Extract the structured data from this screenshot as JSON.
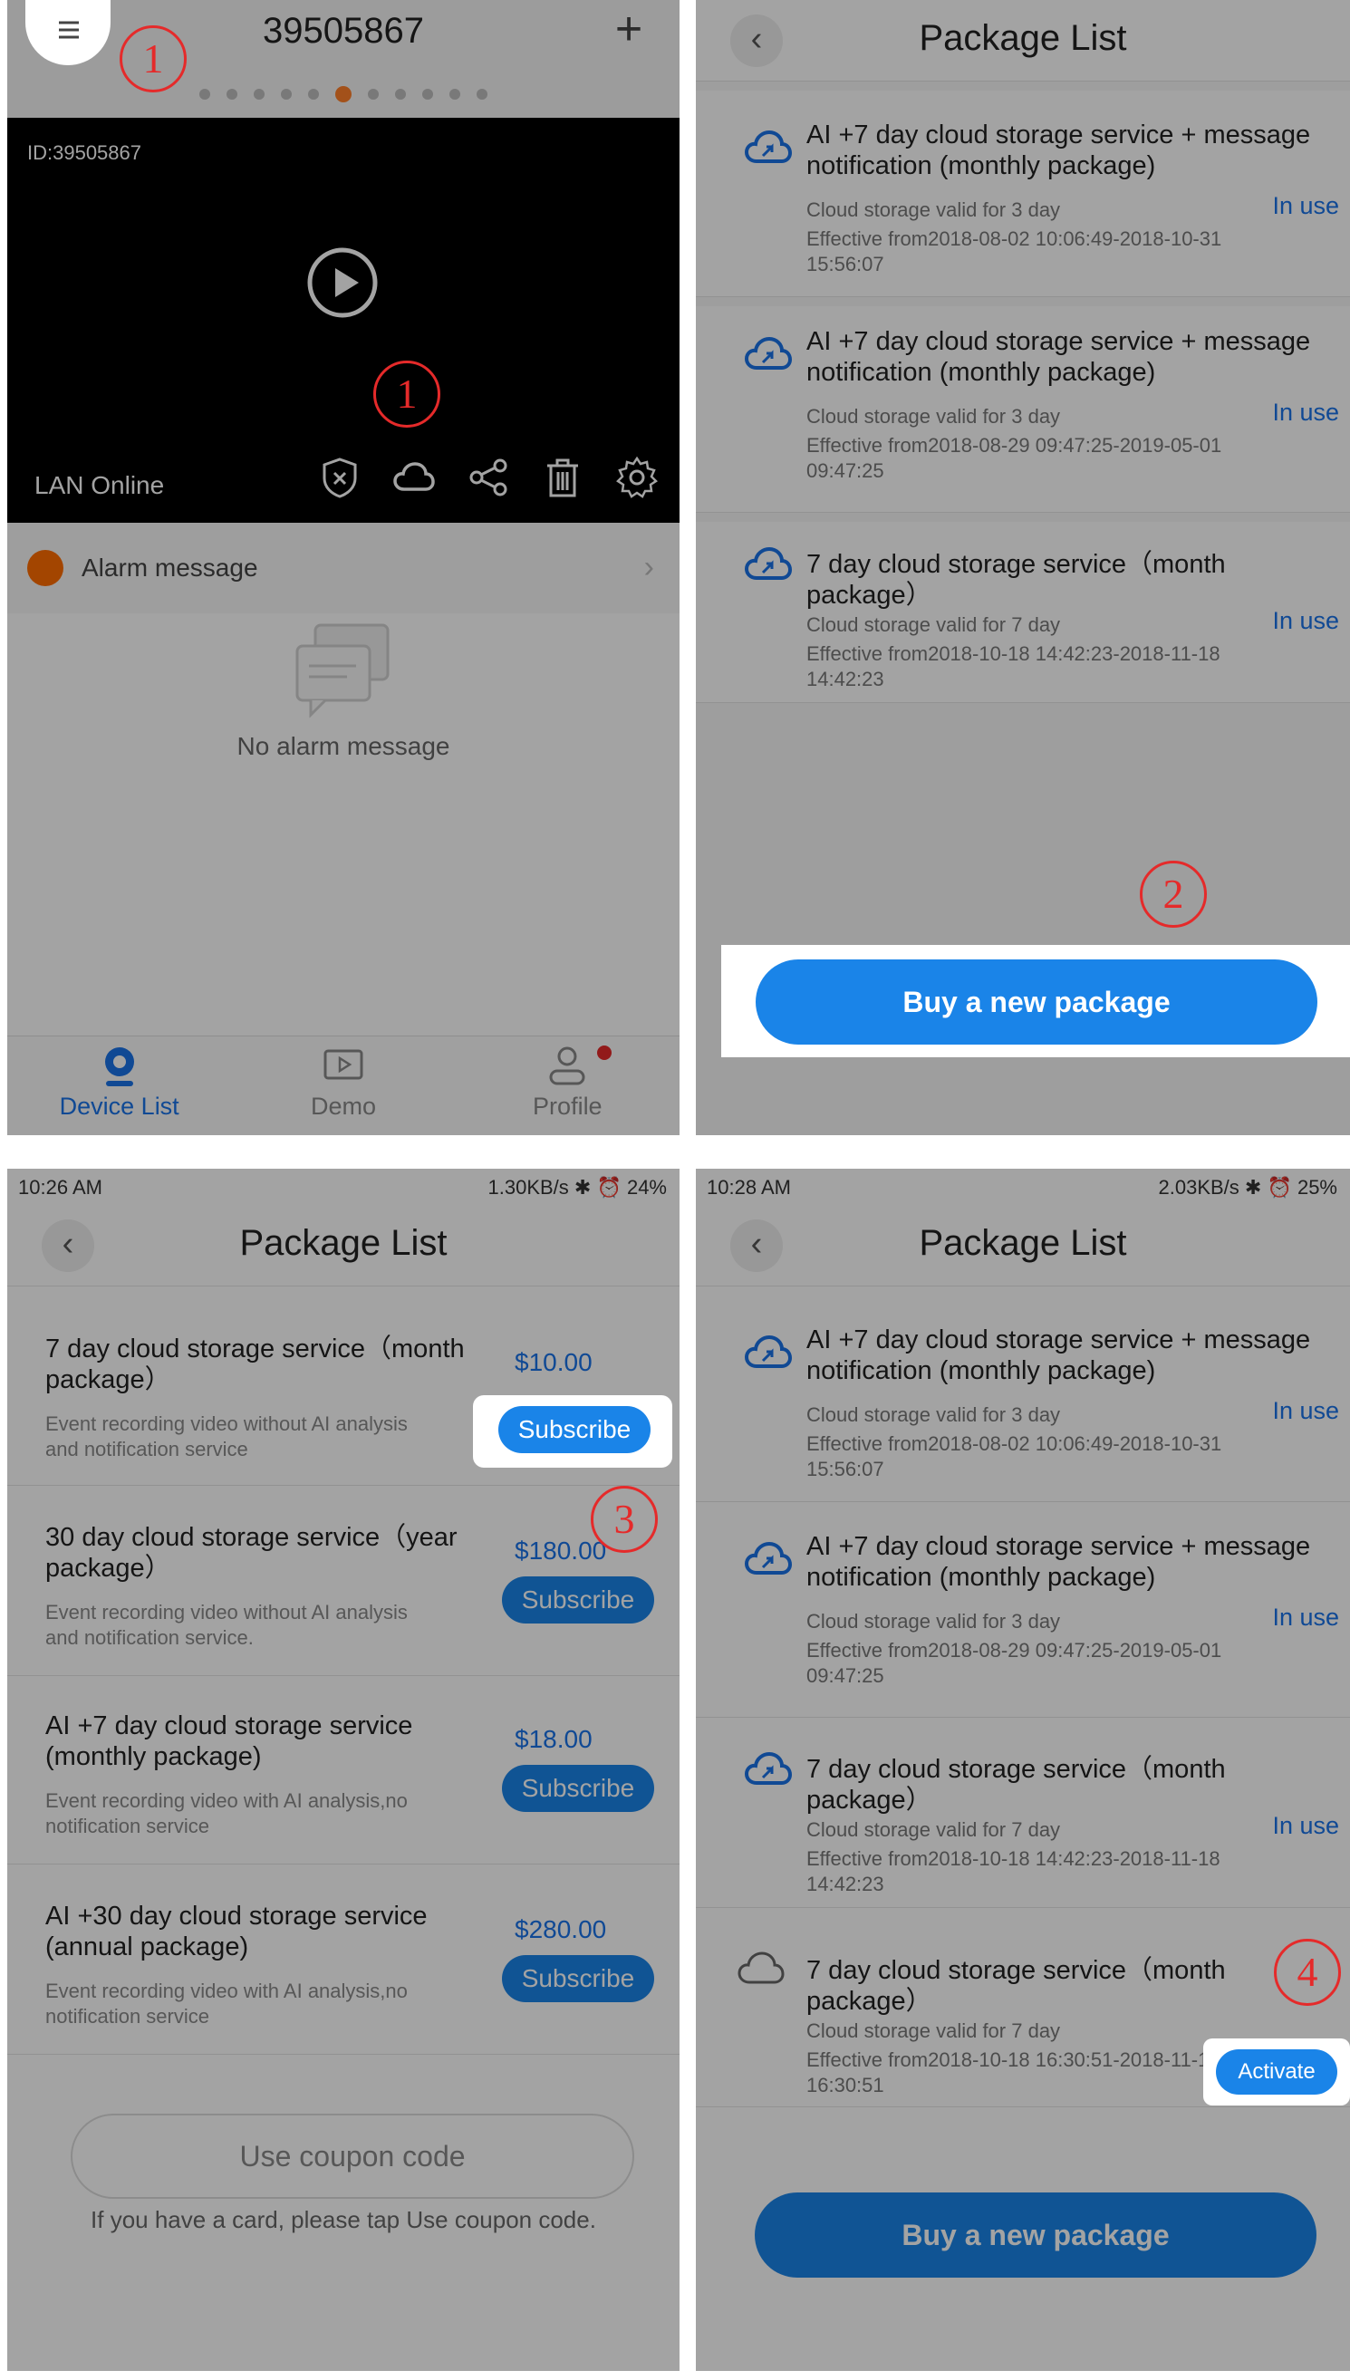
{
  "panel1": {
    "device_number": "39505867",
    "video_id": "ID:39505867",
    "status": "LAN Online",
    "alarm_label": "Alarm message",
    "no_alarm": "No alarm message",
    "tabs": [
      "Device List",
      "Demo",
      "Profile"
    ],
    "marker_menu": "1",
    "marker_cloud": "1"
  },
  "panel2": {
    "title": "Package List",
    "packages": [
      {
        "name": "AI +7 day cloud storage service + message notification (monthly package)",
        "valid": "Cloud storage valid for 3 day",
        "effective": "Effective from2018-08-02 10:06:49-2018-10-31 15:56:07",
        "status": "In use"
      },
      {
        "name": "AI +7 day cloud storage service + message notification (monthly package)",
        "valid": "Cloud storage valid for 3 day",
        "effective": "Effective from2018-08-29 09:47:25-2019-05-01 09:47:25",
        "status": "In use"
      },
      {
        "name": "7 day cloud storage service（month package）",
        "valid": "Cloud storage valid for 7 day",
        "effective": "Effective from2018-10-18 14:42:23-2018-11-18 14:42:23",
        "status": "In use"
      }
    ],
    "buy_label": "Buy a new package",
    "marker": "2"
  },
  "panel3": {
    "status_time": "10:26 AM",
    "status_right": "1.30KB/s ✱ ⏰ 24%",
    "title": "Package List",
    "items": [
      {
        "name": "7 day cloud storage service（month package）",
        "desc": "Event recording video without AI analysis and notification service",
        "price": "$10.00",
        "button": "Subscribe"
      },
      {
        "name": "30 day cloud storage service（year package）",
        "desc": "Event recording video without AI analysis and notification service.",
        "price": "$180.00",
        "button": "Subscribe"
      },
      {
        "name": "AI +7 day cloud storage service (monthly package)",
        "desc": "Event recording video with AI analysis,no notification service",
        "price": "$18.00",
        "button": "Subscribe"
      },
      {
        "name": "AI +30 day cloud storage service (annual package)",
        "desc": "Event recording video with AI analysis,no notification service",
        "price": "$280.00",
        "button": "Subscribe"
      }
    ],
    "coupon_label": "Use coupon code",
    "coupon_hint": "If you have a card, please tap Use coupon code.",
    "marker": "3"
  },
  "panel4": {
    "status_time": "10:28 AM",
    "status_right": "2.03KB/s ✱ ⏰ 25%",
    "title": "Package List",
    "packages": [
      {
        "name": "AI +7 day cloud storage service + message notification (monthly package)",
        "valid": "Cloud storage valid for 3 day",
        "effective": "Effective from2018-08-02 10:06:49-2018-10-31 15:56:07",
        "status": "In use"
      },
      {
        "name": "AI +7 day cloud storage service + message notification (monthly package)",
        "valid": "Cloud storage valid for 3 day",
        "effective": "Effective from2018-08-29 09:47:25-2019-05-01 09:47:25",
        "status": "In use"
      },
      {
        "name": "7 day cloud storage service（month package）",
        "valid": "Cloud storage valid for 7 day",
        "effective": "Effective from2018-10-18 14:42:23-2018-11-18 14:42:23",
        "status": "In use"
      },
      {
        "name": "7 day cloud storage service（month package）",
        "valid": "Cloud storage valid for 7 day",
        "effective": "Effective from2018-10-18 16:30:51-2018-11-18 16:30:51",
        "status": "Activate"
      }
    ],
    "buy_label": "Buy a new package",
    "marker": "4"
  },
  "colors": {
    "accent": "#1a84e8",
    "marker": "#e52a2a",
    "active_dot": "#ff7f2a",
    "alarm": "#ff6d00"
  },
  "icons": [
    "menu-icon",
    "plus-icon",
    "play-icon",
    "shield-icon",
    "cloud-icon",
    "share-icon",
    "trash-icon",
    "gear-icon",
    "back-icon",
    "camera-icon",
    "demo-icon",
    "profile-icon"
  ]
}
